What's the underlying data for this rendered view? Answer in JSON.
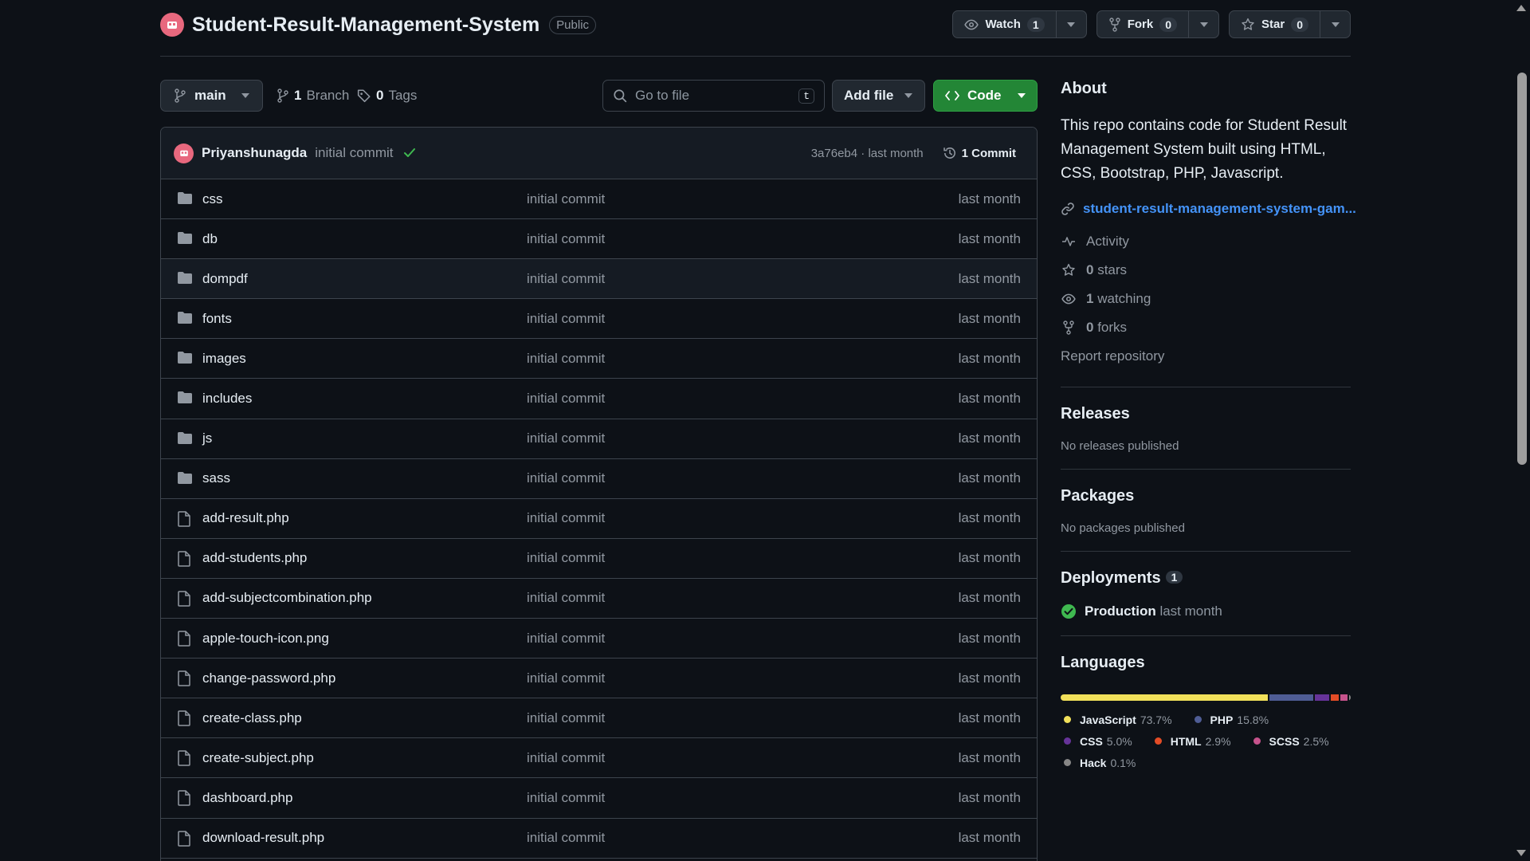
{
  "repo": {
    "name": "Student-Result-Management-System",
    "visibility": "Public"
  },
  "actions": {
    "watch_label": "Watch",
    "watch_count": "1",
    "fork_label": "Fork",
    "fork_count": "0",
    "star_label": "Star",
    "star_count": "0"
  },
  "toolbar": {
    "branch": "main",
    "branches_count": "1",
    "branches_label": "Branch",
    "tags_count": "0",
    "tags_label": "Tags",
    "goto_placeholder": "Go to file",
    "goto_shortcut": "t",
    "add_file_label": "Add file",
    "code_label": "Code"
  },
  "latest_commit": {
    "author": "Priyanshunagda",
    "message": "initial commit",
    "sha_and_time": "3a76eb4 · last month",
    "commits_label": "1 Commit"
  },
  "files": [
    {
      "name": "css",
      "type": "dir",
      "message": "initial commit",
      "date": "last month"
    },
    {
      "name": "db",
      "type": "dir",
      "message": "initial commit",
      "date": "last month"
    },
    {
      "name": "dompdf",
      "type": "dir",
      "message": "initial commit",
      "date": "last month"
    },
    {
      "name": "fonts",
      "type": "dir",
      "message": "initial commit",
      "date": "last month"
    },
    {
      "name": "images",
      "type": "dir",
      "message": "initial commit",
      "date": "last month"
    },
    {
      "name": "includes",
      "type": "dir",
      "message": "initial commit",
      "date": "last month"
    },
    {
      "name": "js",
      "type": "dir",
      "message": "initial commit",
      "date": "last month"
    },
    {
      "name": "sass",
      "type": "dir",
      "message": "initial commit",
      "date": "last month"
    },
    {
      "name": "add-result.php",
      "type": "file",
      "message": "initial commit",
      "date": "last month"
    },
    {
      "name": "add-students.php",
      "type": "file",
      "message": "initial commit",
      "date": "last month"
    },
    {
      "name": "add-subjectcombination.php",
      "type": "file",
      "message": "initial commit",
      "date": "last month"
    },
    {
      "name": "apple-touch-icon.png",
      "type": "file",
      "message": "initial commit",
      "date": "last month"
    },
    {
      "name": "change-password.php",
      "type": "file",
      "message": "initial commit",
      "date": "last month"
    },
    {
      "name": "create-class.php",
      "type": "file",
      "message": "initial commit",
      "date": "last month"
    },
    {
      "name": "create-subject.php",
      "type": "file",
      "message": "initial commit",
      "date": "last month"
    },
    {
      "name": "dashboard.php",
      "type": "file",
      "message": "initial commit",
      "date": "last month"
    },
    {
      "name": "download-result.php",
      "type": "file",
      "message": "initial commit",
      "date": "last month"
    }
  ],
  "about": {
    "heading": "About",
    "description": "This repo contains code for Student Result Management System built using HTML, CSS, Bootstrap, PHP, Javascript.",
    "homepage": "student-result-management-system-gam...",
    "activity": "Activity",
    "stars_count": "0",
    "stars_label": "stars",
    "watching_count": "1",
    "watching_label": "watching",
    "forks_count": "0",
    "forks_label": "forks",
    "report": "Report repository"
  },
  "releases": {
    "heading": "Releases",
    "text": "No releases published"
  },
  "packages": {
    "heading": "Packages",
    "text": "No packages published"
  },
  "deployments": {
    "heading": "Deployments",
    "count": "1",
    "env": "Production",
    "time": "last month"
  },
  "languages": {
    "heading": "Languages",
    "items": [
      {
        "name": "JavaScript",
        "percent": "73.7%",
        "value": 73.7,
        "color": "#f1e05a"
      },
      {
        "name": "PHP",
        "percent": "15.8%",
        "value": 15.8,
        "color": "#4F5D95"
      },
      {
        "name": "CSS",
        "percent": "5.0%",
        "value": 5.0,
        "color": "#663399"
      },
      {
        "name": "HTML",
        "percent": "2.9%",
        "value": 2.9,
        "color": "#e34c26"
      },
      {
        "name": "SCSS",
        "percent": "2.5%",
        "value": 2.5,
        "color": "#c6538c"
      },
      {
        "name": "Hack",
        "percent": "0.1%",
        "value": 0.1,
        "color": "#878787"
      }
    ]
  },
  "icons": {
    "folder": "folder-icon",
    "file": "file-icon",
    "branch": "git-branch-icon",
    "tag": "tag-icon",
    "search": "search-icon",
    "history": "history-icon"
  }
}
